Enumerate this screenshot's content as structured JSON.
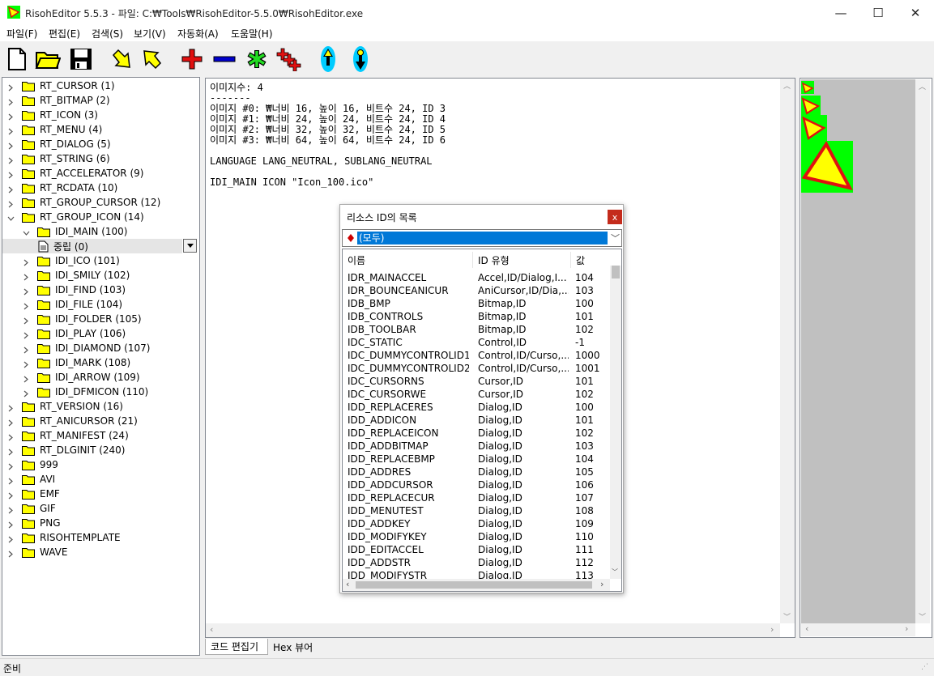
{
  "window": {
    "title": "RisohEditor 5.5.3 - 파일: C:₩Tools₩RisohEditor-5.5.0₩RisohEditor.exe",
    "minimize": "—",
    "maximize": "☐",
    "close": "✕"
  },
  "menu": [
    "파일(F)",
    "편집(E)",
    "검색(S)",
    "보기(V)",
    "자동화(A)",
    "도움말(H)"
  ],
  "toolbar": [
    "new-icon",
    "open-folder-icon",
    "save-icon",
    "arrow-down-right-icon",
    "arrow-up-left-icon",
    "add-icon",
    "remove-icon",
    "asterisk-icon",
    "add-resources-icon",
    "move-up-icon",
    "move-down-icon"
  ],
  "tree": {
    "items": [
      {
        "label": "RT_CURSOR (1)",
        "level": 0,
        "expanded": false
      },
      {
        "label": "RT_BITMAP (2)",
        "level": 0,
        "expanded": false
      },
      {
        "label": "RT_ICON (3)",
        "level": 0,
        "expanded": false
      },
      {
        "label": "RT_MENU (4)",
        "level": 0,
        "expanded": false
      },
      {
        "label": "RT_DIALOG (5)",
        "level": 0,
        "expanded": false
      },
      {
        "label": "RT_STRING (6)",
        "level": 0,
        "expanded": false
      },
      {
        "label": "RT_ACCELERATOR (9)",
        "level": 0,
        "expanded": false
      },
      {
        "label": "RT_RCDATA (10)",
        "level": 0,
        "expanded": false
      },
      {
        "label": "RT_GROUP_CURSOR (12)",
        "level": 0,
        "expanded": false
      },
      {
        "label": "RT_GROUP_ICON (14)",
        "level": 0,
        "expanded": true
      },
      {
        "label": "IDI_MAIN (100)",
        "level": 1,
        "expanded": true
      },
      {
        "label": "중립 (0)",
        "level": 2,
        "expanded": false,
        "selected": true
      },
      {
        "label": "IDI_ICO (101)",
        "level": 1,
        "expanded": false
      },
      {
        "label": "IDI_SMILY (102)",
        "level": 1,
        "expanded": false
      },
      {
        "label": "IDI_FIND (103)",
        "level": 1,
        "expanded": false
      },
      {
        "label": "IDI_FILE (104)",
        "level": 1,
        "expanded": false
      },
      {
        "label": "IDI_FOLDER (105)",
        "level": 1,
        "expanded": false
      },
      {
        "label": "IDI_PLAY (106)",
        "level": 1,
        "expanded": false
      },
      {
        "label": "IDI_DIAMOND (107)",
        "level": 1,
        "expanded": false
      },
      {
        "label": "IDI_MARK (108)",
        "level": 1,
        "expanded": false
      },
      {
        "label": "IDI_ARROW (109)",
        "level": 1,
        "expanded": false
      },
      {
        "label": "IDI_DFMICON (110)",
        "level": 1,
        "expanded": false
      },
      {
        "label": "RT_VERSION (16)",
        "level": 0,
        "expanded": false
      },
      {
        "label": "RT_ANICURSOR (21)",
        "level": 0,
        "expanded": false
      },
      {
        "label": "RT_MANIFEST (24)",
        "level": 0,
        "expanded": false
      },
      {
        "label": "RT_DLGINIT (240)",
        "level": 0,
        "expanded": false
      },
      {
        "label": "999",
        "level": 0,
        "expanded": false
      },
      {
        "label": "AVI",
        "level": 0,
        "expanded": false
      },
      {
        "label": "EMF",
        "level": 0,
        "expanded": false
      },
      {
        "label": "GIF",
        "level": 0,
        "expanded": false
      },
      {
        "label": "PNG",
        "level": 0,
        "expanded": false
      },
      {
        "label": "RISOHTEMPLATE",
        "level": 0,
        "expanded": false
      },
      {
        "label": "WAVE",
        "level": 0,
        "expanded": false
      }
    ]
  },
  "editor": {
    "code": "이미지수: 4\n-------\n이미지 #0: ₩너비 16, 높이 16, 비트수 24, ID 3\n이미지 #1: ₩너비 24, 높이 24, 비트수 24, ID 4\n이미지 #2: ₩너비 32, 높이 32, 비트수 24, ID 5\n이미지 #3: ₩너비 64, 높이 64, 비트수 24, ID 6\n\nLANGUAGE LANG_NEUTRAL, SUBLANG_NEUTRAL\n\nIDI_MAIN ICON \"Icon_100.ico\"",
    "tabs": [
      "코드 편집기",
      "Hex 뷰어"
    ]
  },
  "status": {
    "text": "준비"
  },
  "dialog": {
    "title": "리소스 ID의 목록",
    "close": "x",
    "combo_value": "(모두)",
    "columns": [
      "이름",
      "ID 유형",
      "값"
    ],
    "rows": [
      [
        "IDR_MAINACCEL",
        "Accel,ID/Dialog,I...",
        "104"
      ],
      [
        "IDR_BOUNCEANICUR",
        "AniCursor,ID/Dia,...",
        "103"
      ],
      [
        "IDB_BMP",
        "Bitmap,ID",
        "100"
      ],
      [
        "IDB_CONTROLS",
        "Bitmap,ID",
        "101"
      ],
      [
        "IDB_TOOLBAR",
        "Bitmap,ID",
        "102"
      ],
      [
        "IDC_STATIC",
        "Control,ID",
        "-1"
      ],
      [
        "IDC_DUMMYCONTROLID1",
        "Control,ID/Curso,...",
        "1000"
      ],
      [
        "IDC_DUMMYCONTROLID2",
        "Control,ID/Curso,...",
        "1001"
      ],
      [
        "IDC_CURSORNS",
        "Cursor,ID",
        "101"
      ],
      [
        "IDC_CURSORWE",
        "Cursor,ID",
        "102"
      ],
      [
        "IDD_REPLACERES",
        "Dialog,ID",
        "100"
      ],
      [
        "IDD_ADDICON",
        "Dialog,ID",
        "101"
      ],
      [
        "IDD_REPLACEICON",
        "Dialog,ID",
        "102"
      ],
      [
        "IDD_ADDBITMAP",
        "Dialog,ID",
        "103"
      ],
      [
        "IDD_REPLACEBMP",
        "Dialog,ID",
        "104"
      ],
      [
        "IDD_ADDRES",
        "Dialog,ID",
        "105"
      ],
      [
        "IDD_ADDCURSOR",
        "Dialog,ID",
        "106"
      ],
      [
        "IDD_REPLACECUR",
        "Dialog,ID",
        "107"
      ],
      [
        "IDD_MENUTEST",
        "Dialog,ID",
        "108"
      ],
      [
        "IDD_ADDKEY",
        "Dialog,ID",
        "109"
      ],
      [
        "IDD_MODIFYKEY",
        "Dialog,ID",
        "110"
      ],
      [
        "IDD_EDITACCEL",
        "Dialog,ID",
        "111"
      ],
      [
        "IDD_ADDSTR",
        "Dialog,ID",
        "112"
      ],
      [
        "IDD_MODIFYSTR",
        "Dialog,ID",
        "113"
      ]
    ]
  },
  "colors": {
    "folder": "#ffff00",
    "selection": "#0078d7",
    "icon_bg": "#00ff00",
    "icon_fill": "#ffff00",
    "icon_border": "#e01010",
    "preview_bg": "#c0c0c0"
  }
}
